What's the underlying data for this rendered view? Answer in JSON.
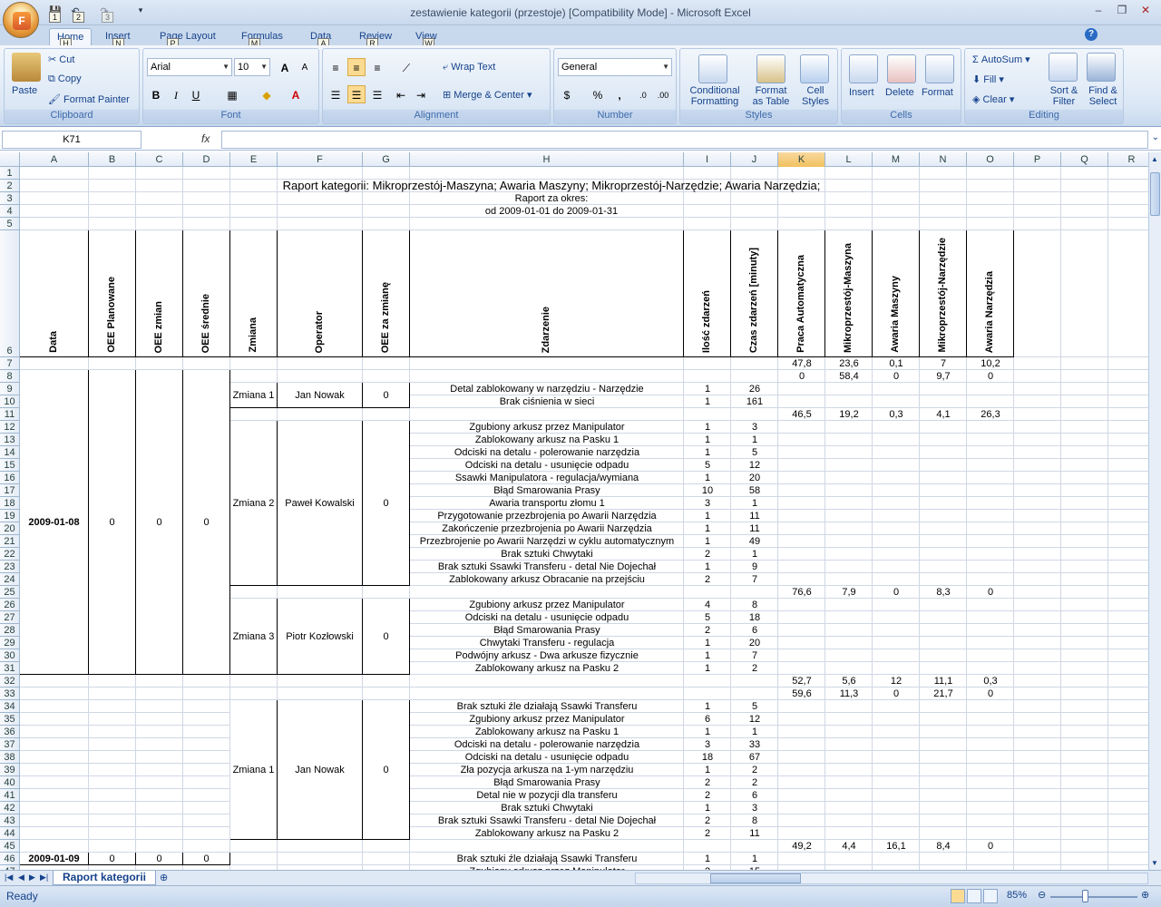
{
  "window": {
    "title": "zestawienie kategorii (przestoje)  [Compatibility Mode] - Microsoft Excel",
    "qat": [
      "1",
      "2",
      "3"
    ]
  },
  "ribbon": {
    "tabs": [
      {
        "label": "Home",
        "key": "H"
      },
      {
        "label": "Insert",
        "key": "N"
      },
      {
        "label": "Page Layout",
        "key": "P"
      },
      {
        "label": "Formulas",
        "key": "M"
      },
      {
        "label": "Data",
        "key": "A"
      },
      {
        "label": "Review",
        "key": "R"
      },
      {
        "label": "View",
        "key": "W"
      }
    ],
    "clipboard": {
      "label": "Clipboard",
      "paste": "Paste",
      "cut": "Cut",
      "copy": "Copy",
      "format_painter": "Format Painter"
    },
    "font": {
      "label": "Font",
      "name": "Arial",
      "size": "10"
    },
    "alignment": {
      "label": "Alignment",
      "wrap": "Wrap Text",
      "merge": "Merge & Center"
    },
    "number": {
      "label": "Number",
      "format": "General"
    },
    "styles": {
      "label": "Styles",
      "cond": "Conditional",
      "cond2": "Formatting",
      "fmt_table": "Format",
      "fmt_table2": "as Table",
      "cell_styles": "Cell",
      "cell_styles2": "Styles"
    },
    "cells": {
      "label": "Cells",
      "insert": "Insert",
      "delete": "Delete",
      "format": "Format"
    },
    "editing": {
      "label": "Editing",
      "autosum": "AutoSum",
      "fill": "Fill",
      "clear": "Clear",
      "sort": "Sort &",
      "sort2": "Filter",
      "find": "Find &",
      "find2": "Select"
    }
  },
  "formula_bar": {
    "name_box": "K71",
    "fx": "fx",
    "formula": ""
  },
  "sheet": {
    "columns": [
      "A",
      "B",
      "C",
      "D",
      "E",
      "F",
      "G",
      "H",
      "I",
      "J",
      "K",
      "L",
      "M",
      "N",
      "O",
      "P",
      "Q",
      "R"
    ],
    "selected_column": "K",
    "title": "Raport kategorii: Mikroprzestój-Maszyna; Awaria Maszyny; Mikroprzestój-Narzędzie; Awaria Narzędzia;",
    "period_label": "Raport za okres:",
    "period": "od 2009-01-01 do 2009-01-31",
    "headers": [
      "Data",
      "OEE Planowane",
      "OEE zmian",
      "OEE średnie",
      "Zmiana",
      "Operator",
      "OEE za zmianę",
      "Zdarzenie",
      "Ilość zdarzeń",
      "Czas zdarzeń [minuty]",
      "Praca Automatyczna",
      "Mikroprzestój-Maszyna",
      "Awaria Maszyny",
      "Mikroprzestój-Narzędzie",
      "Awaria Narzędzia"
    ],
    "cells": [
      {
        "r": 7,
        "c": "K",
        "v": "47,8"
      },
      {
        "r": 7,
        "c": "L",
        "v": "23,6"
      },
      {
        "r": 7,
        "c": "M",
        "v": "0,1"
      },
      {
        "r": 7,
        "c": "N",
        "v": "7"
      },
      {
        "r": 7,
        "c": "O",
        "v": "10,2"
      },
      {
        "r": 8,
        "c": "K",
        "v": "0"
      },
      {
        "r": 8,
        "c": "L",
        "v": "58,4"
      },
      {
        "r": 8,
        "c": "M",
        "v": "0"
      },
      {
        "r": 8,
        "c": "N",
        "v": "9,7"
      },
      {
        "r": 8,
        "c": "O",
        "v": "0"
      },
      {
        "r": 9,
        "c": "H",
        "v": "Detal zablokowany w narzędziu - Narzędzie"
      },
      {
        "r": 9,
        "c": "I",
        "v": "1"
      },
      {
        "r": 9,
        "c": "J",
        "v": "26"
      },
      {
        "r": 10,
        "c": "H",
        "v": "Brak ciśnienia w sieci"
      },
      {
        "r": 10,
        "c": "I",
        "v": "1"
      },
      {
        "r": 10,
        "c": "J",
        "v": "161"
      },
      {
        "r": 11,
        "c": "K",
        "v": "46,5"
      },
      {
        "r": 11,
        "c": "L",
        "v": "19,2"
      },
      {
        "r": 11,
        "c": "M",
        "v": "0,3"
      },
      {
        "r": 11,
        "c": "N",
        "v": "4,1"
      },
      {
        "r": 11,
        "c": "O",
        "v": "26,3"
      },
      {
        "r": 12,
        "c": "H",
        "v": "Zgubiony arkusz przez Manipulator"
      },
      {
        "r": 12,
        "c": "I",
        "v": "1"
      },
      {
        "r": 12,
        "c": "J",
        "v": "3"
      },
      {
        "r": 13,
        "c": "H",
        "v": "Zablokowany arkusz na Pasku 1"
      },
      {
        "r": 13,
        "c": "I",
        "v": "1"
      },
      {
        "r": 13,
        "c": "J",
        "v": "1"
      },
      {
        "r": 14,
        "c": "H",
        "v": "Odciski na detalu - polerowanie narzędzia"
      },
      {
        "r": 14,
        "c": "I",
        "v": "1"
      },
      {
        "r": 14,
        "c": "J",
        "v": "5"
      },
      {
        "r": 15,
        "c": "H",
        "v": "Odciski na detalu - usunięcie odpadu"
      },
      {
        "r": 15,
        "c": "I",
        "v": "5"
      },
      {
        "r": 15,
        "c": "J",
        "v": "12"
      },
      {
        "r": 16,
        "c": "H",
        "v": "Ssawki Manipulatora - regulacja/wymiana"
      },
      {
        "r": 16,
        "c": "I",
        "v": "1"
      },
      {
        "r": 16,
        "c": "J",
        "v": "20"
      },
      {
        "r": 17,
        "c": "H",
        "v": "Błąd Smarowania Prasy"
      },
      {
        "r": 17,
        "c": "I",
        "v": "10"
      },
      {
        "r": 17,
        "c": "J",
        "v": "58"
      },
      {
        "r": 18,
        "c": "H",
        "v": "Awaria transportu złomu 1"
      },
      {
        "r": 18,
        "c": "I",
        "v": "3"
      },
      {
        "r": 18,
        "c": "J",
        "v": "1"
      },
      {
        "r": 19,
        "c": "H",
        "v": "Przygotowanie przezbrojenia po Awarii Narzędzia"
      },
      {
        "r": 19,
        "c": "I",
        "v": "1"
      },
      {
        "r": 19,
        "c": "J",
        "v": "11"
      },
      {
        "r": 20,
        "c": "H",
        "v": "Zakończenie przezbrojenia po Awarii Narzędzia"
      },
      {
        "r": 20,
        "c": "I",
        "v": "1"
      },
      {
        "r": 20,
        "c": "J",
        "v": "11"
      },
      {
        "r": 21,
        "c": "H",
        "v": "Przezbrojenie po Awarii Narzędzi w cyklu automatycznym"
      },
      {
        "r": 21,
        "c": "I",
        "v": "1"
      },
      {
        "r": 21,
        "c": "J",
        "v": "49"
      },
      {
        "r": 22,
        "c": "H",
        "v": "Brak sztuki Chwytaki"
      },
      {
        "r": 22,
        "c": "I",
        "v": "2"
      },
      {
        "r": 22,
        "c": "J",
        "v": "1"
      },
      {
        "r": 23,
        "c": "H",
        "v": "Brak sztuki Ssawki Transferu - detal Nie Dojechał"
      },
      {
        "r": 23,
        "c": "I",
        "v": "1"
      },
      {
        "r": 23,
        "c": "J",
        "v": "9"
      },
      {
        "r": 24,
        "c": "H",
        "v": "Zablokowany arkusz Obracanie na przejściu"
      },
      {
        "r": 24,
        "c": "I",
        "v": "2"
      },
      {
        "r": 24,
        "c": "J",
        "v": "7"
      },
      {
        "r": 25,
        "c": "K",
        "v": "76,6"
      },
      {
        "r": 25,
        "c": "L",
        "v": "7,9"
      },
      {
        "r": 25,
        "c": "M",
        "v": "0"
      },
      {
        "r": 25,
        "c": "N",
        "v": "8,3"
      },
      {
        "r": 25,
        "c": "O",
        "v": "0"
      },
      {
        "r": 26,
        "c": "H",
        "v": "Zgubiony arkusz przez Manipulator"
      },
      {
        "r": 26,
        "c": "I",
        "v": "4"
      },
      {
        "r": 26,
        "c": "J",
        "v": "8"
      },
      {
        "r": 27,
        "c": "H",
        "v": "Odciski na detalu - usunięcie odpadu"
      },
      {
        "r": 27,
        "c": "I",
        "v": "5"
      },
      {
        "r": 27,
        "c": "J",
        "v": "18"
      },
      {
        "r": 28,
        "c": "H",
        "v": "Błąd Smarowania Prasy"
      },
      {
        "r": 28,
        "c": "I",
        "v": "2"
      },
      {
        "r": 28,
        "c": "J",
        "v": "6"
      },
      {
        "r": 29,
        "c": "H",
        "v": "Chwytaki Transferu - regulacja"
      },
      {
        "r": 29,
        "c": "I",
        "v": "1"
      },
      {
        "r": 29,
        "c": "J",
        "v": "20"
      },
      {
        "r": 30,
        "c": "H",
        "v": "Podwójny arkusz - Dwa arkusze fizycznie"
      },
      {
        "r": 30,
        "c": "I",
        "v": "1"
      },
      {
        "r": 30,
        "c": "J",
        "v": "7"
      },
      {
        "r": 31,
        "c": "H",
        "v": "Zablokowany arkusz na Pasku 2"
      },
      {
        "r": 31,
        "c": "I",
        "v": "1"
      },
      {
        "r": 31,
        "c": "J",
        "v": "2"
      },
      {
        "r": 32,
        "c": "K",
        "v": "52,7"
      },
      {
        "r": 32,
        "c": "L",
        "v": "5,6"
      },
      {
        "r": 32,
        "c": "M",
        "v": "12"
      },
      {
        "r": 32,
        "c": "N",
        "v": "11,1"
      },
      {
        "r": 32,
        "c": "O",
        "v": "0,3"
      },
      {
        "r": 33,
        "c": "K",
        "v": "59,6"
      },
      {
        "r": 33,
        "c": "L",
        "v": "11,3"
      },
      {
        "r": 33,
        "c": "M",
        "v": "0"
      },
      {
        "r": 33,
        "c": "N",
        "v": "21,7"
      },
      {
        "r": 33,
        "c": "O",
        "v": "0"
      },
      {
        "r": 34,
        "c": "H",
        "v": "Brak sztuki źle działają Ssawki Transferu"
      },
      {
        "r": 34,
        "c": "I",
        "v": "1"
      },
      {
        "r": 34,
        "c": "J",
        "v": "5"
      },
      {
        "r": 35,
        "c": "H",
        "v": "Zgubiony arkusz przez Manipulator"
      },
      {
        "r": 35,
        "c": "I",
        "v": "6"
      },
      {
        "r": 35,
        "c": "J",
        "v": "12"
      },
      {
        "r": 36,
        "c": "H",
        "v": "Zablokowany arkusz na Pasku 1"
      },
      {
        "r": 36,
        "c": "I",
        "v": "1"
      },
      {
        "r": 36,
        "c": "J",
        "v": "1"
      },
      {
        "r": 37,
        "c": "H",
        "v": "Odciski na detalu - polerowanie narzędzia"
      },
      {
        "r": 37,
        "c": "I",
        "v": "3"
      },
      {
        "r": 37,
        "c": "J",
        "v": "33"
      },
      {
        "r": 38,
        "c": "H",
        "v": "Odciski na detalu - usunięcie odpadu"
      },
      {
        "r": 38,
        "c": "I",
        "v": "18"
      },
      {
        "r": 38,
        "c": "J",
        "v": "67"
      },
      {
        "r": 39,
        "c": "H",
        "v": "Zła pozycja arkusza na 1-ym narzędziu"
      },
      {
        "r": 39,
        "c": "I",
        "v": "1"
      },
      {
        "r": 39,
        "c": "J",
        "v": "2"
      },
      {
        "r": 40,
        "c": "H",
        "v": "Błąd Smarowania Prasy"
      },
      {
        "r": 40,
        "c": "I",
        "v": "2"
      },
      {
        "r": 40,
        "c": "J",
        "v": "2"
      },
      {
        "r": 41,
        "c": "H",
        "v": "Detal nie w pozycji dla transferu"
      },
      {
        "r": 41,
        "c": "I",
        "v": "2"
      },
      {
        "r": 41,
        "c": "J",
        "v": "6"
      },
      {
        "r": 42,
        "c": "H",
        "v": "Brak sztuki Chwytaki"
      },
      {
        "r": 42,
        "c": "I",
        "v": "1"
      },
      {
        "r": 42,
        "c": "J",
        "v": "3"
      },
      {
        "r": 43,
        "c": "H",
        "v": "Brak sztuki Ssawki Transferu - detal Nie Dojechał"
      },
      {
        "r": 43,
        "c": "I",
        "v": "2"
      },
      {
        "r": 43,
        "c": "J",
        "v": "8"
      },
      {
        "r": 44,
        "c": "H",
        "v": "Zablokowany arkusz na Pasku 2"
      },
      {
        "r": 44,
        "c": "I",
        "v": "2"
      },
      {
        "r": 44,
        "c": "J",
        "v": "11"
      },
      {
        "r": 45,
        "c": "K",
        "v": "49,2"
      },
      {
        "r": 45,
        "c": "L",
        "v": "4,4"
      },
      {
        "r": 45,
        "c": "M",
        "v": "16,1"
      },
      {
        "r": 45,
        "c": "N",
        "v": "8,4"
      },
      {
        "r": 45,
        "c": "O",
        "v": "0"
      },
      {
        "r": 46,
        "c": "H",
        "v": "Brak sztuki źle działają Ssawki Transferu"
      },
      {
        "r": 46,
        "c": "I",
        "v": "1"
      },
      {
        "r": 46,
        "c": "J",
        "v": "1"
      }
    ],
    "merged": [
      {
        "r1": 9,
        "r2": 10,
        "c": "E",
        "v": "Zmiana 1"
      },
      {
        "r1": 9,
        "r2": 10,
        "c": "F",
        "v": "Jan Nowak"
      },
      {
        "r1": 9,
        "r2": 10,
        "c": "G",
        "v": "0"
      },
      {
        "r1": 12,
        "r2": 24,
        "c": "E",
        "v": "Zmiana 2"
      },
      {
        "r1": 12,
        "r2": 24,
        "c": "F",
        "v": "Paweł Kowalski"
      },
      {
        "r1": 12,
        "r2": 24,
        "c": "G",
        "v": "0"
      },
      {
        "r1": 26,
        "r2": 31,
        "c": "E",
        "v": "Zmiana 3"
      },
      {
        "r1": 26,
        "r2": 31,
        "c": "F",
        "v": "Piotr Kozłowski"
      },
      {
        "r1": 26,
        "r2": 31,
        "c": "G",
        "v": "0"
      },
      {
        "r1": 8,
        "r2": 31,
        "c": "A",
        "v": "2009-01-08",
        "bold": true
      },
      {
        "r1": 8,
        "r2": 31,
        "c": "B",
        "v": "0"
      },
      {
        "r1": 8,
        "r2": 31,
        "c": "C",
        "v": "0"
      },
      {
        "r1": 8,
        "r2": 31,
        "c": "D",
        "v": "0"
      },
      {
        "r1": 34,
        "r2": 44,
        "c": "E",
        "v": "Zmiana 1"
      },
      {
        "r1": 34,
        "r2": 44,
        "c": "F",
        "v": "Jan Nowak"
      },
      {
        "r1": 34,
        "r2": 44,
        "c": "G",
        "v": "0"
      },
      {
        "r1": 46,
        "r2": 46,
        "c": "A",
        "v": "2009-01-09",
        "bold": true
      },
      {
        "r1": 46,
        "r2": 46,
        "c": "B",
        "v": "0"
      },
      {
        "r1": 46,
        "r2": 46,
        "c": "C",
        "v": "0"
      },
      {
        "r1": 46,
        "r2": 46,
        "c": "D",
        "v": "0"
      }
    ],
    "last_row_partial": {
      "r": 47,
      "cells": [
        {
          "c": "H",
          "v": "Zgubiony arkusz przez Manipulator"
        },
        {
          "c": "I",
          "v": "2"
        },
        {
          "c": "J",
          "v": "15"
        }
      ]
    }
  },
  "sheet_tabs": {
    "active": "Raport kategorii"
  },
  "status": {
    "text": "Ready",
    "zoom": "85%",
    "zoom_level": 0.4
  }
}
